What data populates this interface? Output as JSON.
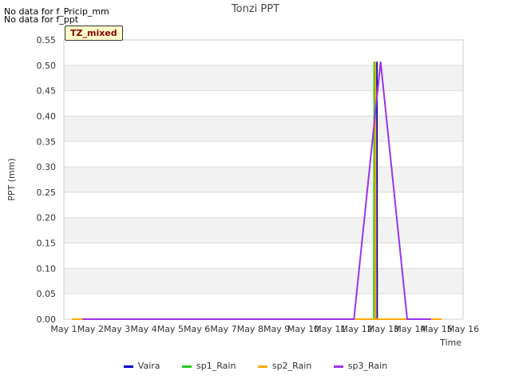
{
  "messages": [
    "No data for f_Pricip_mm",
    "No data for f_ppt"
  ],
  "badge": "TZ_mixed",
  "chart_data": {
    "type": "line",
    "title": "Tonzi PPT",
    "xlabel": "Time",
    "ylabel": "PPT (mm)",
    "ylim": [
      0,
      0.55
    ],
    "xlim": [
      1,
      16
    ],
    "grid": "horizontal bands",
    "legend": "bottom",
    "x_ticks": [
      "May 1",
      "May 2",
      "May 3",
      "May 4",
      "May 5",
      "May 6",
      "May 7",
      "May 8",
      "May 9",
      "May 10",
      "May 11",
      "May 12",
      "May 13",
      "May 14",
      "May 15",
      "May 16"
    ],
    "y_ticks": [
      "0.00",
      "0.05",
      "0.10",
      "0.15",
      "0.20",
      "0.25",
      "0.30",
      "0.35",
      "0.40",
      "0.45",
      "0.50",
      "0.55"
    ],
    "series": [
      {
        "name": "Vaira",
        "color": "#0000cc",
        "points": [
          [
            1.3,
            0
          ],
          [
            12.75,
            0
          ],
          [
            12.76,
            0.507
          ],
          [
            12.77,
            0
          ],
          [
            14.8,
            0
          ]
        ]
      },
      {
        "name": "sp1_Rain",
        "color": "#22cc22",
        "points": [
          [
            1.3,
            0
          ],
          [
            12.65,
            0
          ],
          [
            12.66,
            0.507
          ],
          [
            12.67,
            0
          ],
          [
            14.8,
            0
          ]
        ]
      },
      {
        "name": "sp2_Rain",
        "color": "#ffaa00",
        "points": [
          [
            1.3,
            0
          ],
          [
            12.7,
            0
          ],
          [
            12.71,
            0.507
          ],
          [
            12.72,
            0
          ],
          [
            15.2,
            0
          ]
        ]
      },
      {
        "name": "sp3_Rain",
        "color": "#9933ee",
        "points": [
          [
            1.7,
            0
          ],
          [
            11.9,
            0
          ],
          [
            12.9,
            0.507
          ],
          [
            13.9,
            0
          ],
          [
            14.8,
            0
          ]
        ]
      }
    ]
  }
}
